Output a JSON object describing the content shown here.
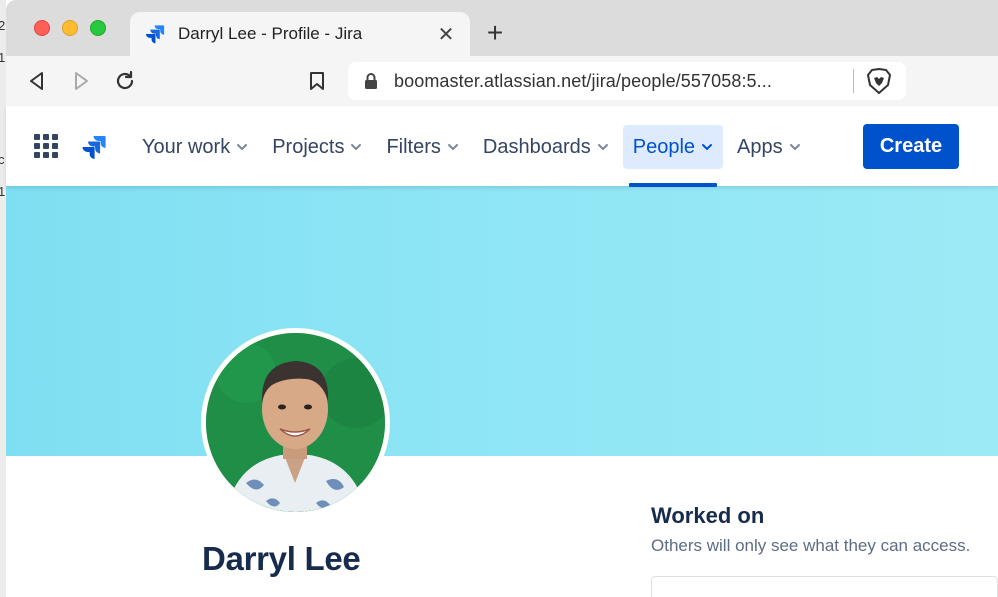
{
  "edge_fragments": [
    "2",
    "1",
    "c",
    "1"
  ],
  "browser": {
    "tab_title": "Darryl Lee - Profile - Jira",
    "url": "boomaster.atlassian.net/jira/people/557058:5..."
  },
  "nav": {
    "items": [
      {
        "label": "Your work",
        "active": false
      },
      {
        "label": "Projects",
        "active": false
      },
      {
        "label": "Filters",
        "active": false
      },
      {
        "label": "Dashboards",
        "active": false
      },
      {
        "label": "People",
        "active": true
      },
      {
        "label": "Apps",
        "active": false
      }
    ],
    "create_label": "Create"
  },
  "profile": {
    "name": "Darryl Lee"
  },
  "worked_on": {
    "title": "Worked on",
    "subtitle": "Others will only see what they can access."
  },
  "colors": {
    "brand": "#0052cc",
    "banner": "#8fe6f5",
    "text": "#172b4d"
  }
}
